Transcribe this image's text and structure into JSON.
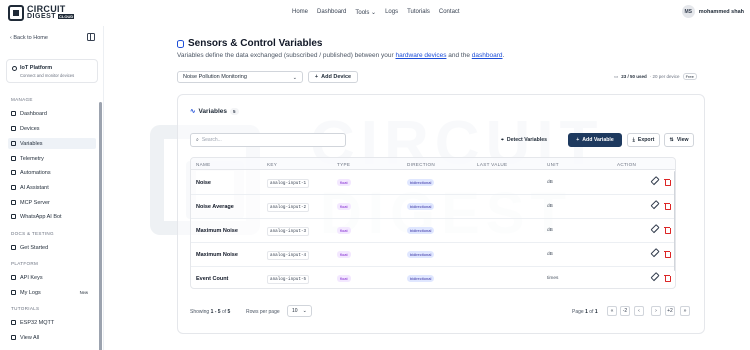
{
  "brand": {
    "line1": "CIRCUIT",
    "line2": "DIGEST",
    "tag": "CLOUD"
  },
  "nav": {
    "items": [
      "Home",
      "Dashboard",
      "Tools ⌄",
      "Logs",
      "Tutorials",
      "Contact"
    ]
  },
  "user": {
    "initials": "MS",
    "name": "mohammed shah"
  },
  "sidebar": {
    "back": "‹ Back to Home",
    "platform": {
      "title": "IoT Platform",
      "subtitle": "Connect and monitor devices"
    },
    "sections": [
      {
        "label": "MANAGE",
        "items": [
          "Dashboard",
          "Devices",
          "Variables",
          "Telemetry",
          "Automations",
          "AI Assistant",
          "MCP Server",
          "WhatsApp AI Bot"
        ]
      },
      {
        "label": "DOCS & TESTING",
        "items": [
          "Get Started"
        ]
      },
      {
        "label": "PLATFORM",
        "items": [
          "API Keys",
          "My Logs"
        ]
      },
      {
        "label": "TUTORIALS",
        "items": [
          "ESP32 MQTT",
          "View All"
        ]
      }
    ],
    "new_badge": "New",
    "active": "Variables"
  },
  "page": {
    "title": "Sensors & Control Variables",
    "desc_before": "Variables define the data exchanged (subscribed / published) between your ",
    "desc_link1": "hardware devices",
    "desc_mid": " and the ",
    "desc_link2": "dashboard",
    "desc_after": "."
  },
  "device_select": {
    "value": "Noise Pollution Monitoring",
    "chevron": "⌄"
  },
  "add_device_label": "Add Device",
  "quota": {
    "used": "23 / 50 used",
    "devices": "· 20 per device",
    "plan": "Free"
  },
  "variables": {
    "title": "Variables",
    "count": "5",
    "search_placeholder": "Search...",
    "detect_label": "Detect Variables",
    "add_label": "Add Variable",
    "export_label": "Export",
    "view_label": "View",
    "columns": [
      "NAME",
      "KEY",
      "TYPE",
      "DIRECTION",
      "LAST VALUE",
      "UNIT",
      "ACTION"
    ],
    "rows": [
      {
        "name": "Noise",
        "key": "analog-input-1",
        "type": "float",
        "direction": "bidirectional",
        "last_value": "",
        "unit": "dB"
      },
      {
        "name": "Noise Average",
        "key": "analog-input-2",
        "type": "float",
        "direction": "bidirectional",
        "last_value": "",
        "unit": "dB"
      },
      {
        "name": "Maximum Noise",
        "key": "analog-input-3",
        "type": "float",
        "direction": "bidirectional",
        "last_value": "",
        "unit": "dB"
      },
      {
        "name": "Maximum Noise",
        "key": "analog-input-4",
        "type": "float",
        "direction": "bidirectional",
        "last_value": "",
        "unit": "dB"
      },
      {
        "name": "Event Count",
        "key": "analog-input-5",
        "type": "float",
        "direction": "bidirectional",
        "last_value": "",
        "unit": "times"
      }
    ],
    "footer": {
      "showing_prefix": "Showing",
      "showing_range": "1 - 5",
      "showing_of": "of",
      "showing_total": "5",
      "rows_per_page_label": "Rows per page",
      "rows_per_page": "10",
      "page_prefix": "Page",
      "page_current": "1",
      "page_of": "of",
      "page_total": "1",
      "pager": [
        "«",
        "-2",
        "‹",
        "›",
        "+2",
        "»"
      ]
    }
  },
  "watermark": {
    "line1": "CIRCUIT",
    "line2": "DIGEST"
  }
}
